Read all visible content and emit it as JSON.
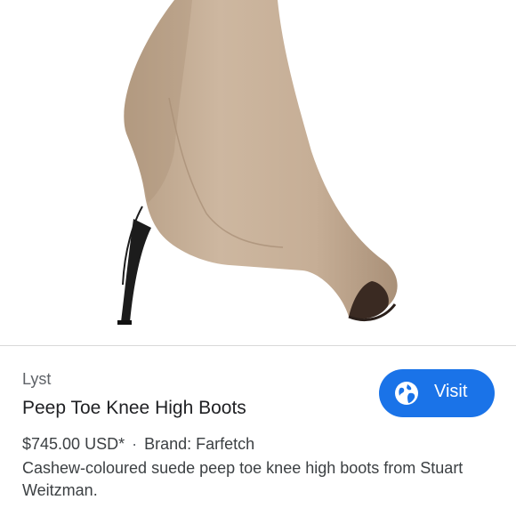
{
  "product_image": {
    "icon": "peep-toe-boot-image",
    "colors": {
      "suede": "#c9b29b",
      "suede_shadow": "#ad957c",
      "heel": "#1c1c1c"
    }
  },
  "result": {
    "source": "Lyst",
    "title": "Peep Toe Knee High Boots",
    "price": "$745.00 USD*",
    "separator": "·",
    "brand": "Brand: Farfetch",
    "description": "Cashew-coloured suede peep toe knee high boots from Stuart Weitzman."
  },
  "visit_button": {
    "label": "Visit",
    "icon": "globe-icon",
    "color": "#1a73e8"
  }
}
